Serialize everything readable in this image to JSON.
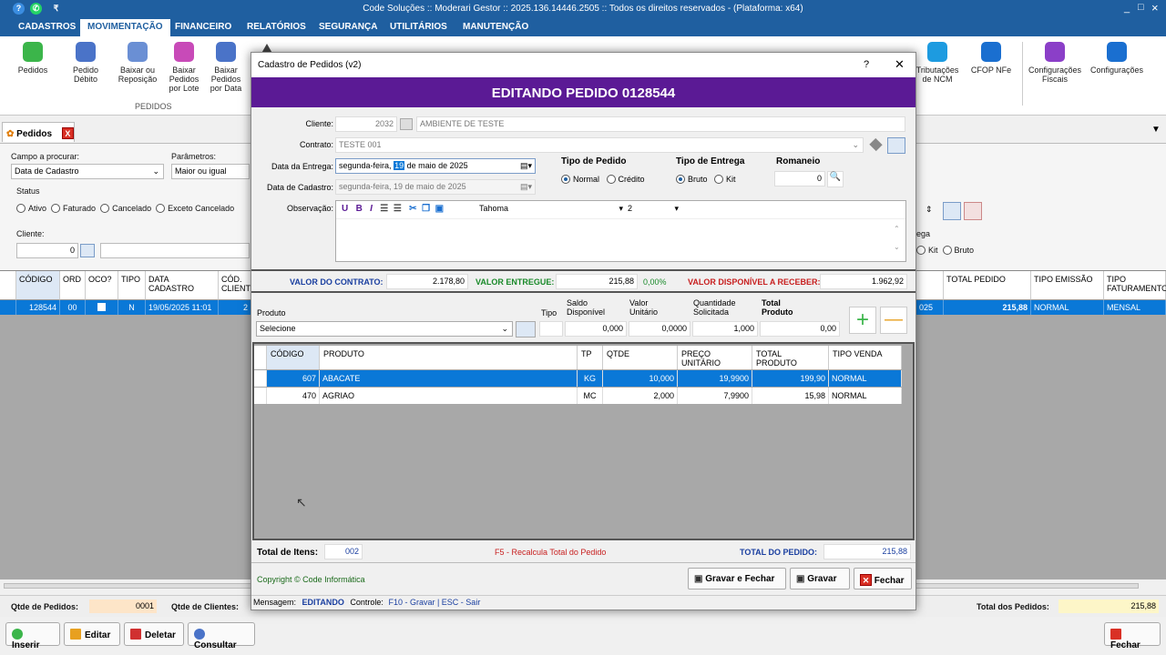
{
  "window": {
    "title": "Code Soluções :: Moderari Gestor :: 2025.136.14446.2505 :: Todos os direitos reservados - (Plataforma: x64)",
    "min": "_",
    "max": "□",
    "close": "×"
  },
  "menu": [
    "CADASTROS",
    "MOVIMENTAÇÃO",
    "FINANCEIRO",
    "RELATÓRIOS",
    "SEGURANÇA",
    "UTILITÁRIOS",
    "MANUTENÇÃO"
  ],
  "ribbon": {
    "pedidos": "Pedidos",
    "pedido_debito": "Pedido Débito",
    "baixar_reposicao": "Baixar ou Reposição",
    "baixar_lote": "Baixar Pedidos por Lote",
    "baixar_data": "Baixar Pedidos por Data",
    "group": "PEDIDOS",
    "tributacoes": "Tributações de NCM",
    "cfop": "CFOP NFe",
    "config_fiscais": "Configurações Fiscais",
    "configuracoes": "Configurações"
  },
  "doctab": {
    "label": "Pedidos",
    "close": "X"
  },
  "filter": {
    "campo_label": "Campo a procurar:",
    "campo_value": "Data de Cadastro",
    "param_label": "Parâmetros:",
    "param_value": "Maior ou igual",
    "status_label": "Status",
    "status": [
      "Ativo",
      "Faturado",
      "Cancelado",
      "Exceto Cancelado"
    ],
    "cliente_label": "Cliente:",
    "cliente_value": "0",
    "entrega_label": "ega",
    "entrega_opts": [
      "Kit",
      "Bruto"
    ]
  },
  "grid": {
    "headers": [
      "CÓDIGO",
      "ORD",
      "OCO?",
      "TIPO",
      "DATA CADASTRO",
      "CÓD. CLIENTE",
      "TOTAL PEDIDO",
      "TIPO EMISSÃO",
      "TIPO FATURAMENTO"
    ],
    "row": {
      "codigo": "128544",
      "ord": "00",
      "tipo": "N",
      "data": "19/05/2025 11:01",
      "cliente_frag": "2",
      "data_frag": "025",
      "total": "215,88",
      "emissao": "NORMAL",
      "faturamento": "MENSAL"
    }
  },
  "status": {
    "qtde_pedidos_label": "Qtde de Pedidos:",
    "qtde_pedidos": "0001",
    "qtde_clientes_label": "Qtde de Clientes:",
    "total_label": "Total dos Pedidos:",
    "total": "215,88"
  },
  "buttons": {
    "inserir": "Inserir",
    "editar": "Editar",
    "deletar": "Deletar",
    "consultar": "Consultar",
    "fechar": "Fechar"
  },
  "modal": {
    "title": "Cadastro de Pedidos (v2)",
    "help": "?",
    "close": "✕",
    "banner": "EDITANDO PEDIDO 0128544",
    "cliente_label": "Cliente:",
    "cliente_code": "2032",
    "cliente_name": "AMBIENTE DE TESTE",
    "contrato_label": "Contrato:",
    "contrato_value": "TESTE 001",
    "data_entrega_label": "Data da Entrega:",
    "data_entrega_day": "segunda-feira,",
    "data_entrega_num": "19",
    "data_entrega_rest": "de    maio    de 2025",
    "data_cadastro_label": "Data de Cadastro:",
    "data_cadastro": "segunda-feira, 19 de    maio    de 2025",
    "tipo_pedido_label": "Tipo de Pedido",
    "tipo_pedido": [
      "Normal",
      "Crédito"
    ],
    "tipo_entrega_label": "Tipo de Entrega",
    "tipo_entrega": [
      "Bruto",
      "Kit"
    ],
    "romaneio_label": "Romaneio",
    "romaneio_value": "0",
    "obs_label": "Observação:",
    "font_name": "Tahoma",
    "font_size": "2",
    "valor_contrato_label": "VALOR DO CONTRATO:",
    "valor_contrato": "2.178,80",
    "valor_entregue_label": "VALOR ENTREGUE:",
    "valor_entregue": "215,88",
    "pct": "0,00%",
    "valor_disp_label": "VALOR DISPONÍVEL A RECEBER:",
    "valor_disp": "1.962,92",
    "produto_label": "Produto",
    "produto_value": "Selecione",
    "tipo_label": "Tipo",
    "saldo_label": "Saldo Disponível",
    "saldo_value": "0,000",
    "valor_unit_label": "Valor Unitário",
    "valor_unit_value": "0,0000",
    "qtd_label": "Quantidade Solicitada",
    "qtd_value": "1,000",
    "total_prod_label": "Total Produto",
    "total_prod_value": "0,00",
    "items_headers": [
      "CÓDIGO",
      "PRODUTO",
      "TP",
      "QTDE",
      "PREÇO UNITÁRIO",
      "TOTAL PRODUTO",
      "TIPO VENDA"
    ],
    "items": [
      {
        "codigo": "607",
        "produto": "ABACATE",
        "tp": "KG",
        "qtde": "10,000",
        "preco": "19,9900",
        "total": "199,90",
        "venda": "NORMAL"
      },
      {
        "codigo": "470",
        "produto": "AGRIAO",
        "tp": "MC",
        "qtde": "2,000",
        "preco": "7,9900",
        "total": "15,98",
        "venda": "NORMAL"
      }
    ],
    "total_itens_label": "Total de Itens:",
    "total_itens": "002",
    "f5_note": "F5 - Recalcula Total do Pedido",
    "total_pedido_label": "TOTAL DO PEDIDO:",
    "total_pedido": "215,88",
    "copyright": "Copyright © Code Informática",
    "gravar_fechar": "Gravar e Fechar",
    "gravar": "Gravar",
    "fechar": "Fechar",
    "msg_label": "Mensagem:",
    "msg_value": "EDITANDO",
    "ctrl_label": "Controle:",
    "ctrl_value": "F10 - Gravar | ESC - Sair"
  }
}
